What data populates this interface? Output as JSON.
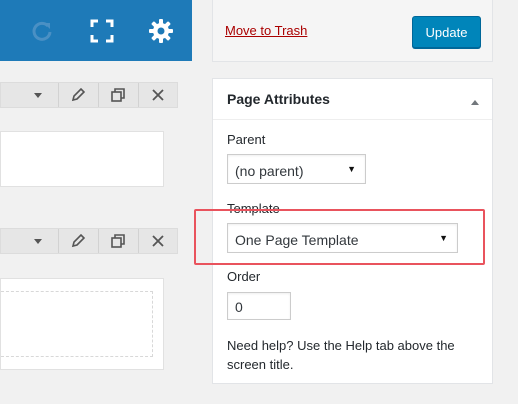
{
  "builder": {
    "toolbar_icons": [
      "refresh-icon",
      "fullscreen-icon",
      "gear-icon"
    ],
    "row_toolbar_icons": [
      "caret-down-icon",
      "pencil-icon",
      "duplicate-icon",
      "close-icon"
    ],
    "accent": "#1e7ab8"
  },
  "publish": {
    "trash_label": "Move to Trash",
    "update_label": "Update"
  },
  "page_attributes": {
    "title": "Page Attributes",
    "parent_label": "Parent",
    "parent_value": "(no parent)",
    "template_label": "Template",
    "template_value": "One Page Template",
    "order_label": "Order",
    "order_value": "0",
    "help_text": "Need help? Use the Help tab above the screen title."
  },
  "colors": {
    "primary_button": "#0085ba",
    "trash_link": "#aa0000",
    "highlight": "#e9535d"
  }
}
